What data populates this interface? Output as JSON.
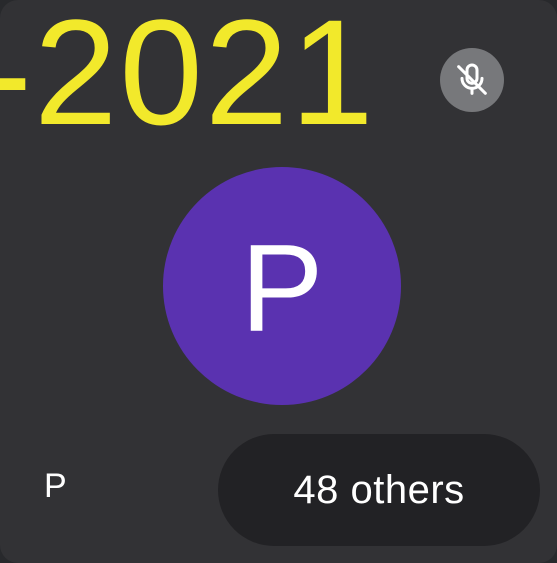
{
  "overlay": {
    "text": "-2021",
    "color": "#f2e92b"
  },
  "mic_status": {
    "icon": "mic-off-icon"
  },
  "participant": {
    "initial": "P",
    "name": "P",
    "avatar_color": "#5a32b0"
  },
  "others": {
    "label": "48 others"
  }
}
